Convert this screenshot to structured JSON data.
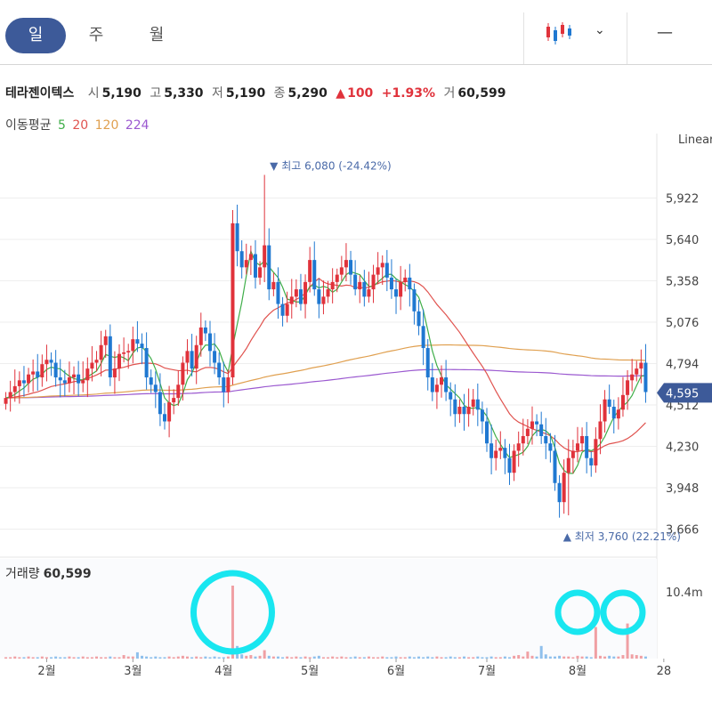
{
  "tabs": [
    {
      "label": "일"
    },
    {
      "label": "주"
    },
    {
      "label": "월"
    }
  ],
  "toolbar": {
    "chart_type_icon": "candlestick-icon",
    "dropdown_icon": "chevron-down-icon",
    "minimize_icon": "minus-icon"
  },
  "stock": {
    "name": "테라젠이텍스",
    "open_label": "시",
    "open": "5,190",
    "high_label": "고",
    "high": "5,330",
    "low_label": "저",
    "low": "5,190",
    "close_label": "종",
    "close": "5,290",
    "change_arrow": "▲",
    "change": "100",
    "change_pct": "+1.93%",
    "volume_label": "거",
    "volume": "60,599"
  },
  "ma_legend": {
    "label": "이동평균",
    "items": [
      {
        "period": "5",
        "color": "#3fae49"
      },
      {
        "period": "20",
        "color": "#e0534f"
      },
      {
        "period": "120",
        "color": "#e0a050"
      },
      {
        "period": "224",
        "color": "#9b59d0"
      }
    ]
  },
  "scale_type": "Linear",
  "volume_panel": {
    "label": "거래량",
    "value": "60,599",
    "max_label": "10.4m"
  },
  "colors": {
    "up": "#e0323b",
    "down": "#1f78d1",
    "current_badge": "#3d5a99",
    "highlight_circle": "#19e6f0"
  },
  "chart_data": {
    "type": "candlestick",
    "ylim": [
      3560,
      6180
    ],
    "y_ticks": [
      "5,922",
      "5,640",
      "5,358",
      "5,076",
      "4,794",
      "4,512",
      "4,230",
      "3,948",
      "3,666"
    ],
    "y_tick_values": [
      5922,
      5640,
      5358,
      5076,
      4794,
      4512,
      4230,
      3948,
      3666
    ],
    "x_ticks": [
      "2월",
      "3월",
      "4월",
      "5월",
      "6월",
      "7월",
      "8월",
      "28"
    ],
    "x_tick_index": [
      9,
      28,
      48,
      67,
      86,
      106,
      126,
      145
    ],
    "current_price_label": "4,595",
    "current_price": 4595,
    "max_annotation": {
      "label": "최고",
      "value": "6,080",
      "pct": "(-24.42%)",
      "price": 6080,
      "index": 57,
      "arrow": "▼"
    },
    "min_annotation": {
      "label": "최저",
      "value": "3,760",
      "pct": "(22.21%)",
      "price": 3760,
      "index": 124,
      "arrow": "▲"
    },
    "close": [
      4560,
      4600,
      4640,
      4680,
      4660,
      4720,
      4740,
      4700,
      4790,
      4820,
      4800,
      4700,
      4680,
      4660,
      4700,
      4720,
      4660,
      4680,
      4760,
      4800,
      4820,
      4920,
      4980,
      4700,
      4760,
      4860,
      4870,
      4880,
      4960,
      4930,
      4900,
      4700,
      4650,
      4600,
      4450,
      4400,
      4530,
      4560,
      4650,
      4800,
      4880,
      4760,
      4920,
      5040,
      5000,
      4880,
      4800,
      4700,
      4600,
      4700,
      5750,
      5560,
      5450,
      5500,
      5540,
      5380,
      5450,
      5600,
      5300,
      5350,
      5200,
      5120,
      5200,
      5250,
      5300,
      5200,
      5350,
      5500,
      5300,
      5200,
      5250,
      5300,
      5350,
      5400,
      5450,
      5500,
      5400,
      5300,
      5350,
      5250,
      5300,
      5400,
      5450,
      5480,
      5380,
      5300,
      5250,
      5350,
      5380,
      5300,
      5150,
      5050,
      4900,
      4700,
      4600,
      4650,
      4700,
      4600,
      4550,
      4450,
      4500,
      4450,
      4500,
      4550,
      4480,
      4400,
      4250,
      4150,
      4200,
      4220,
      4150,
      4050,
      4200,
      4250,
      4300,
      4350,
      4400,
      4380,
      4300,
      4250,
      4200,
      3980,
      3850,
      4050,
      4150,
      4200,
      4250,
      4300,
      4150,
      4100,
      4280,
      4400,
      4550,
      4500,
      4420,
      4480,
      4580,
      4680,
      4720,
      4760,
      4800,
      4600
    ],
    "volume": [
      0.2,
      0.2,
      0.3,
      0.2,
      0.2,
      0.3,
      0.2,
      0.2,
      0.3,
      0.2,
      0.2,
      0.3,
      0.2,
      0.2,
      0.3,
      0.2,
      0.2,
      0.3,
      0.2,
      0.2,
      0.3,
      0.2,
      0.2,
      0.3,
      0.2,
      0.2,
      0.5,
      0.3,
      0.3,
      0.9,
      0.4,
      0.3,
      0.2,
      0.3,
      0.2,
      0.2,
      0.3,
      0.2,
      0.3,
      0.4,
      0.3,
      0.2,
      0.3,
      0.2,
      0.3,
      0.2,
      0.3,
      0.2,
      0.2,
      0.3,
      10.4,
      1.8,
      0.6,
      0.4,
      0.5,
      0.3,
      0.4,
      1.2,
      0.4,
      0.3,
      0.3,
      0.2,
      0.3,
      0.2,
      0.3,
      0.2,
      0.3,
      0.2,
      0.3,
      0.4,
      0.2,
      0.2,
      0.3,
      0.2,
      0.3,
      0.2,
      0.2,
      0.3,
      0.2,
      0.2,
      0.3,
      0.2,
      0.2,
      0.3,
      0.2,
      0.2,
      0.3,
      0.2,
      0.2,
      0.3,
      0.2,
      0.3,
      0.2,
      0.3,
      0.2,
      0.3,
      0.2,
      0.2,
      0.3,
      0.2,
      0.2,
      0.3,
      0.2,
      0.2,
      0.3,
      0.2,
      0.2,
      0.3,
      0.2,
      0.2,
      0.3,
      0.2,
      0.4,
      0.5,
      0.3,
      1.0,
      0.4,
      0.3,
      1.8,
      0.6,
      0.3,
      0.3,
      0.4,
      0.3,
      0.3,
      0.2,
      0.4,
      0.3,
      0.3,
      0.2,
      4.5,
      0.4,
      0.3,
      0.4,
      0.3,
      0.3,
      0.5,
      5.0,
      0.6,
      0.5,
      0.4,
      0.3,
      0.6,
      0.5,
      0.6,
      0.4
    ]
  }
}
